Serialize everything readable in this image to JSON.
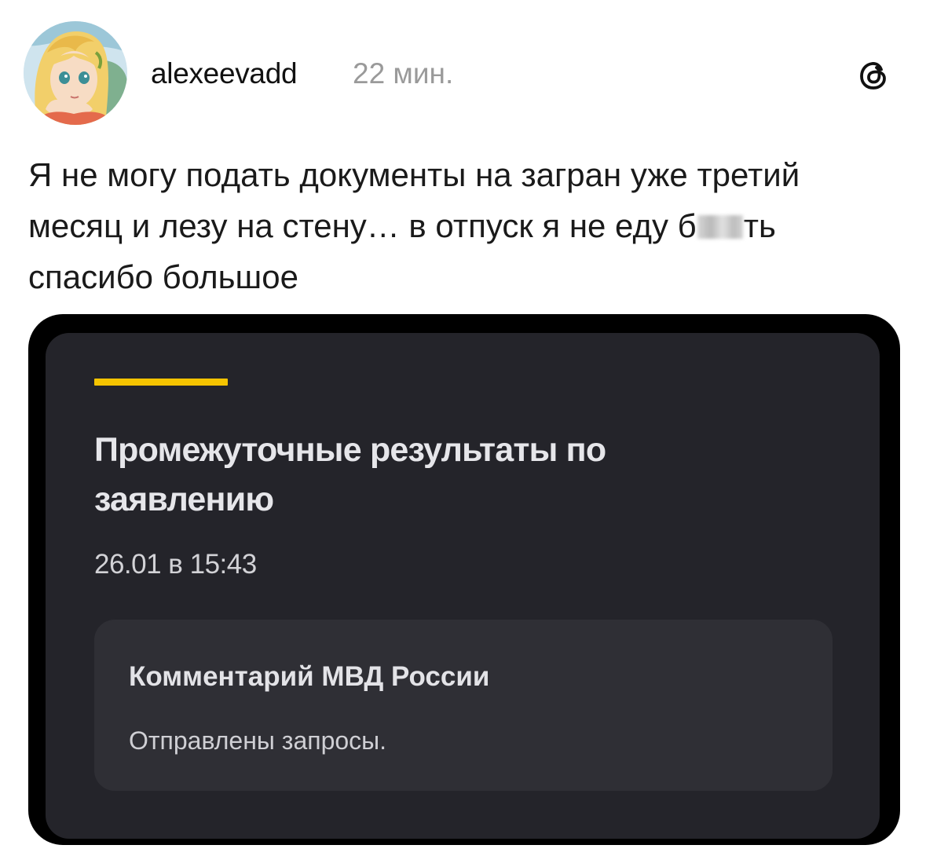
{
  "header": {
    "username": "alexeevadd",
    "time": "22 мин.",
    "avatar_icon": "anime-girl-avatar",
    "app_icon": "threads-icon"
  },
  "post": {
    "lines": [
      "Я не могу подать документы на загран уже третий",
      "месяц и лезу на стену… в отпуск я не еду б",
      "ть",
      "спасибо большое"
    ]
  },
  "embedded_screenshot": {
    "accent_color": "#f5c400",
    "title": "Промежуточные результаты по заявлению",
    "date": "26.01 в 15:43",
    "comment": {
      "heading": "Комментарий МВД России",
      "body": "Отправлены запросы."
    }
  }
}
